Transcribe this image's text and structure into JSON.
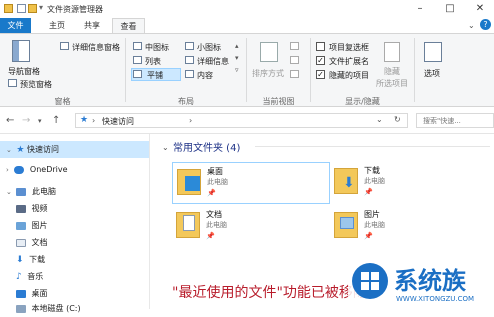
{
  "window": {
    "title": "文件资源管理器"
  },
  "tabs": [
    {
      "label": "文件"
    },
    {
      "label": "主页"
    },
    {
      "label": "共享"
    },
    {
      "label": "查看"
    }
  ],
  "ribbon": {
    "panes": {
      "nav_pane": "导航窗格",
      "preview_pane": "预览窗格",
      "details_pane": "详细信息窗格",
      "group_label": "窗格"
    },
    "layout": {
      "items": [
        "中图标",
        "小图标",
        "列表",
        "详细信息",
        "平铺",
        "内容"
      ],
      "selected": "平铺",
      "group_label": "布局"
    },
    "current_view": {
      "sort_by": "排序方式",
      "group_label": "当前视图"
    },
    "show_hide": {
      "checkboxes": [
        {
          "label": "项目复选框",
          "checked": false
        },
        {
          "label": "文件扩展名",
          "checked": true
        },
        {
          "label": "隐藏的项目",
          "checked": true
        }
      ],
      "hide_selected_line1": "隐藏",
      "hide_selected_line2": "所选项目",
      "group_label": "显示/隐藏"
    },
    "options": "选项"
  },
  "address": {
    "path": "快速访问",
    "search_placeholder": "搜索\"快速..."
  },
  "nav_tree": [
    {
      "label": "快速访问",
      "selected": true,
      "icon": "star-icon"
    },
    {
      "label": "OneDrive",
      "selected": false,
      "icon": "cloud-icon"
    },
    {
      "label": "此电脑",
      "selected": false,
      "icon": "computer-icon"
    },
    {
      "label": "视频",
      "selected": false,
      "icon": "video-icon"
    },
    {
      "label": "图片",
      "selected": false,
      "icon": "picture-icon"
    },
    {
      "label": "文档",
      "selected": false,
      "icon": "document-icon"
    },
    {
      "label": "下载",
      "selected": false,
      "icon": "download-icon"
    },
    {
      "label": "音乐",
      "selected": false,
      "icon": "music-icon"
    },
    {
      "label": "桌面",
      "selected": false,
      "icon": "desktop-icon"
    },
    {
      "label": "本地磁盘 (C:)",
      "selected": false,
      "icon": "disk-icon"
    }
  ],
  "content": {
    "section_title": "常用文件夹 (4)",
    "folders": [
      {
        "name": "桌面",
        "location": "此电脑",
        "selected": true
      },
      {
        "name": "下载",
        "location": "此电脑",
        "selected": false
      },
      {
        "name": "文档",
        "location": "此电脑",
        "selected": false
      },
      {
        "name": "图片",
        "location": "此电脑",
        "selected": false
      }
    ]
  },
  "caption": "\"最近使用的文件\"功能已被移除",
  "watermark": {
    "brand": "系统族",
    "url": "WWW.XITONGZU.COM"
  },
  "colors": {
    "file_tab": "#1979ca",
    "selected_nav": "#cce8ff",
    "caption": "#b81c2b"
  }
}
